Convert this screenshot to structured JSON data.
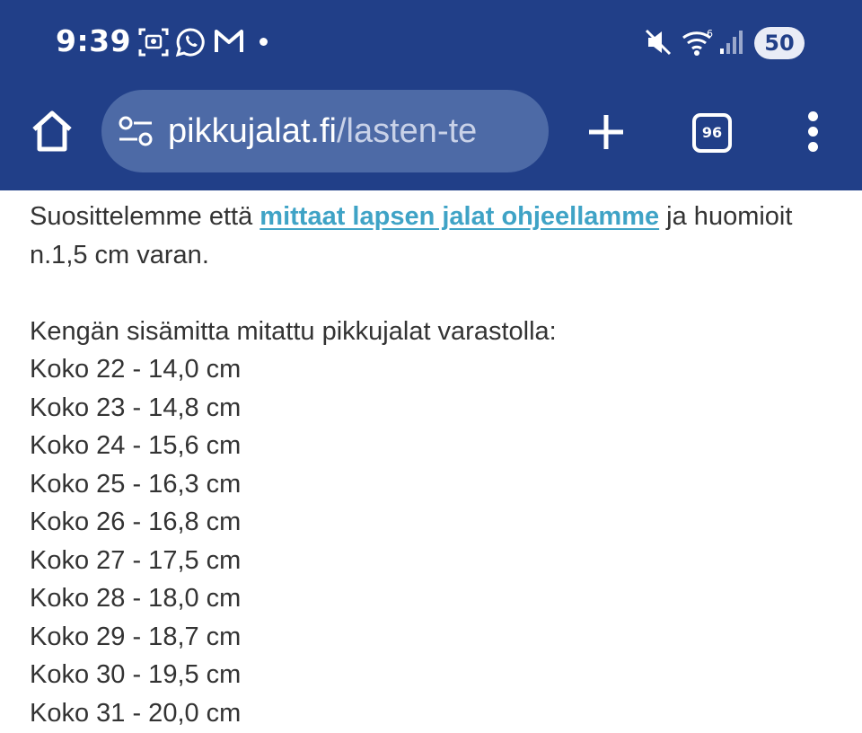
{
  "status_bar": {
    "time": "9:39",
    "battery": "50"
  },
  "browser": {
    "url_domain": "pikkujalat.fi",
    "url_path": "/lasten-te",
    "tab_count": "96"
  },
  "content": {
    "intro_before": "Suosittelemme että ",
    "intro_link": "mittaat lapsen jalat ohjeellamme",
    "intro_after": " ja huomioit n.1,5 cm varan.",
    "heading": "Kengän sisämitta mitattu pikkujalat varastolla:",
    "sizes": [
      "Koko 22 - 14,0 cm",
      "Koko 23 - 14,8 cm",
      "Koko 24 - 15,6 cm",
      "Koko 25 - 16,3 cm",
      "Koko 26 - 16,8 cm",
      "Koko 27 - 17,5 cm",
      "Koko 28 - 18,0 cm",
      "Koko 29 - 18,7 cm",
      "Koko 30 - 19,5 cm",
      "Koko 31 - 20,0 cm"
    ]
  },
  "icons": {
    "status": [
      "screenshot-icon",
      "whatsapp-icon",
      "gmail-icon",
      "mute-icon",
      "wifi-icon",
      "signal-icon"
    ],
    "toolbar": [
      "home-icon",
      "site-settings-icon",
      "new-tab-icon",
      "tab-switcher-icon",
      "menu-icon"
    ]
  },
  "colors": {
    "toolbar_bg": "#213f88",
    "urlbar_bg": "#4d6aa6",
    "link": "#3fa3c6",
    "text": "#333333"
  }
}
